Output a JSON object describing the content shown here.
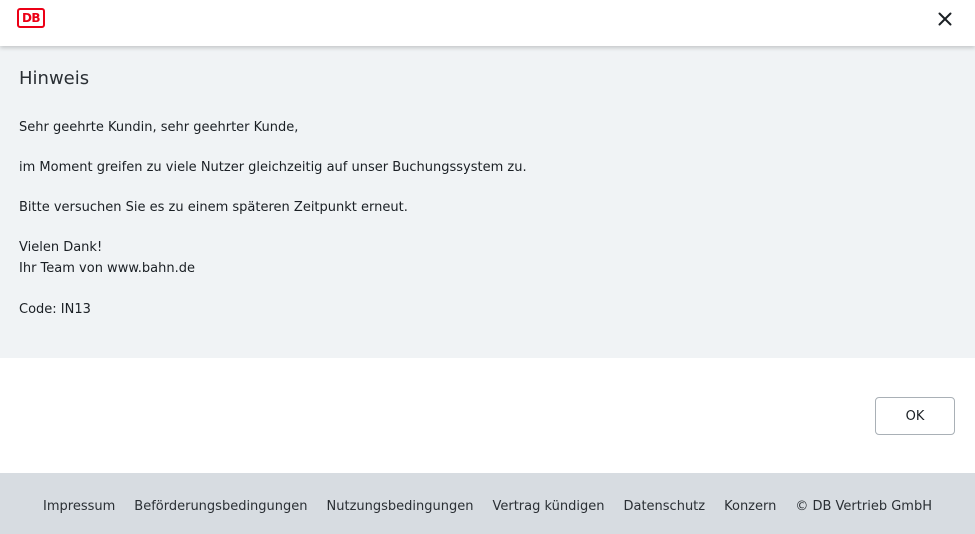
{
  "header": {
    "logo_text": "DB",
    "brand_color": "#ec0016",
    "close_icon": "close-icon"
  },
  "dialog": {
    "title": "Hinweis",
    "lines": {
      "greeting": "Sehr geehrte Kundin, sehr geehrter Kunde,",
      "notice": "im Moment greifen zu viele Nutzer gleichzeitig auf unser Buchungssystem zu.",
      "retry": "Bitte versuchen Sie es zu einem späteren Zeitpunkt erneut.",
      "thanks": "Vielen Dank!",
      "team": "Ihr Team von www.bahn.de",
      "code": "Code: IN13"
    },
    "ok_label": "OK"
  },
  "footer": {
    "links": {
      "impressum": "Impressum",
      "befoerderung": "Beförderungsbedingungen",
      "nutzung": "Nutzungsbedingungen",
      "vertrag": "Vertrag kündigen",
      "datenschutz": "Datenschutz",
      "konzern": "Konzern"
    },
    "copyright": "© DB Vertrieb GmbH"
  }
}
